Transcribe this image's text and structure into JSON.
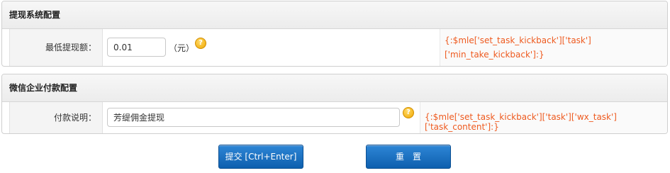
{
  "section1": {
    "title": "提现系统配置",
    "label": "最低提现额：",
    "value": "0.01",
    "unit": "（元）",
    "help_glyph": "?",
    "tip_line1": "{:$mle['set_task_kickback']['task']",
    "tip_line2": "['min_take_kickback']:}"
  },
  "section2": {
    "title": "微信企业付款配置",
    "label": "付款说明：",
    "value": "芳缇佣金提现",
    "help_glyph": "?",
    "tip": "{:$mle['set_task_kickback']['task']['wx_task']['task_content']:}"
  },
  "buttons": {
    "submit": "提交 [Ctrl+Enter]",
    "reset": "重　置"
  },
  "colors": {
    "tip_text": "#ee5a1f",
    "button": "#1a73c8",
    "help_icon": "#f0a800"
  }
}
